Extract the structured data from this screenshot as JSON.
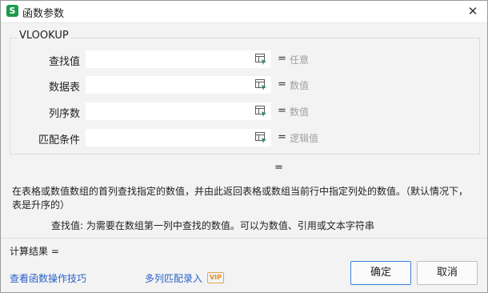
{
  "window": {
    "app_icon_letter": "S",
    "title": "函数参数",
    "close_glyph": "✕"
  },
  "function_name": "VLOOKUP",
  "arguments": [
    {
      "label": "查找值",
      "value": "",
      "equals": "=",
      "hint": "任意"
    },
    {
      "label": "数据表",
      "value": "",
      "equals": "=",
      "hint": "数值"
    },
    {
      "label": "列序数",
      "value": "",
      "equals": "=",
      "hint": "数值"
    },
    {
      "label": "匹配条件",
      "value": "",
      "equals": "=",
      "hint": "逻辑值"
    }
  ],
  "formula_result_equals": "=",
  "description": "在表格或数值数组的首列查找指定的数值，并由此返回表格或数组当前行中指定列处的数值。（默认情况下，表是升序的）",
  "param_description": "查找值:   为需要在数组第一列中查找的数值。可以为数值、引用或文本字符串",
  "calc_result": "计算结果 =",
  "links": {
    "tips": "查看函数操作技巧",
    "multi_match": "多列匹配录入",
    "vip_badge": "VIP"
  },
  "buttons": {
    "ok": "确定",
    "cancel": "取消"
  },
  "colors": {
    "app_icon": "#1e9a4d",
    "link": "#2b62c9",
    "primary_border": "#3c7fd8",
    "vip": "#e08f2a"
  },
  "icons": {
    "ref": "cell-range-select-icon",
    "close": "close-icon"
  }
}
